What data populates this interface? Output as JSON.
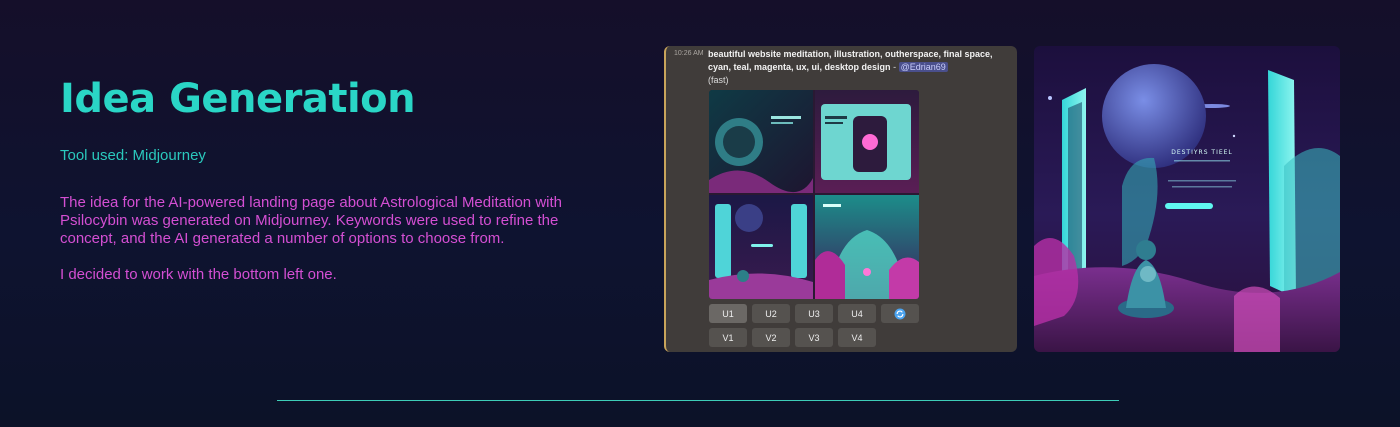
{
  "section": {
    "title": "Idea Generation",
    "tool": "Tool used: Midjourney",
    "paragraphs": [
      "The idea for the AI-powered landing page about Astrological Meditation with Psilocybin was generated on Midjourney. Keywords were used to refine the concept, and the AI generated a number of options to choose from.",
      "I decided to work with the bottom left one."
    ]
  },
  "discord": {
    "timestamp": "10:26 AM",
    "prompt": "beautiful website meditation, illustration, outherspace, final space, cyan, teal, magenta, ux, ui, desktop design",
    "separator": " - ",
    "mention": "@Edrian69",
    "speed": "(fast)",
    "upscale_buttons": [
      "U1",
      "U2",
      "U3",
      "U4"
    ],
    "variation_buttons": [
      "V1",
      "V2",
      "V3",
      "V4"
    ],
    "reroll_icon": "refresh-icon"
  },
  "artwork": {
    "heading": "DESTIYRS TIEEL"
  },
  "colors": {
    "accent_teal": "#2ad6c6",
    "accent_magenta": "#d44fd3",
    "divider": "#3ecdb8"
  }
}
